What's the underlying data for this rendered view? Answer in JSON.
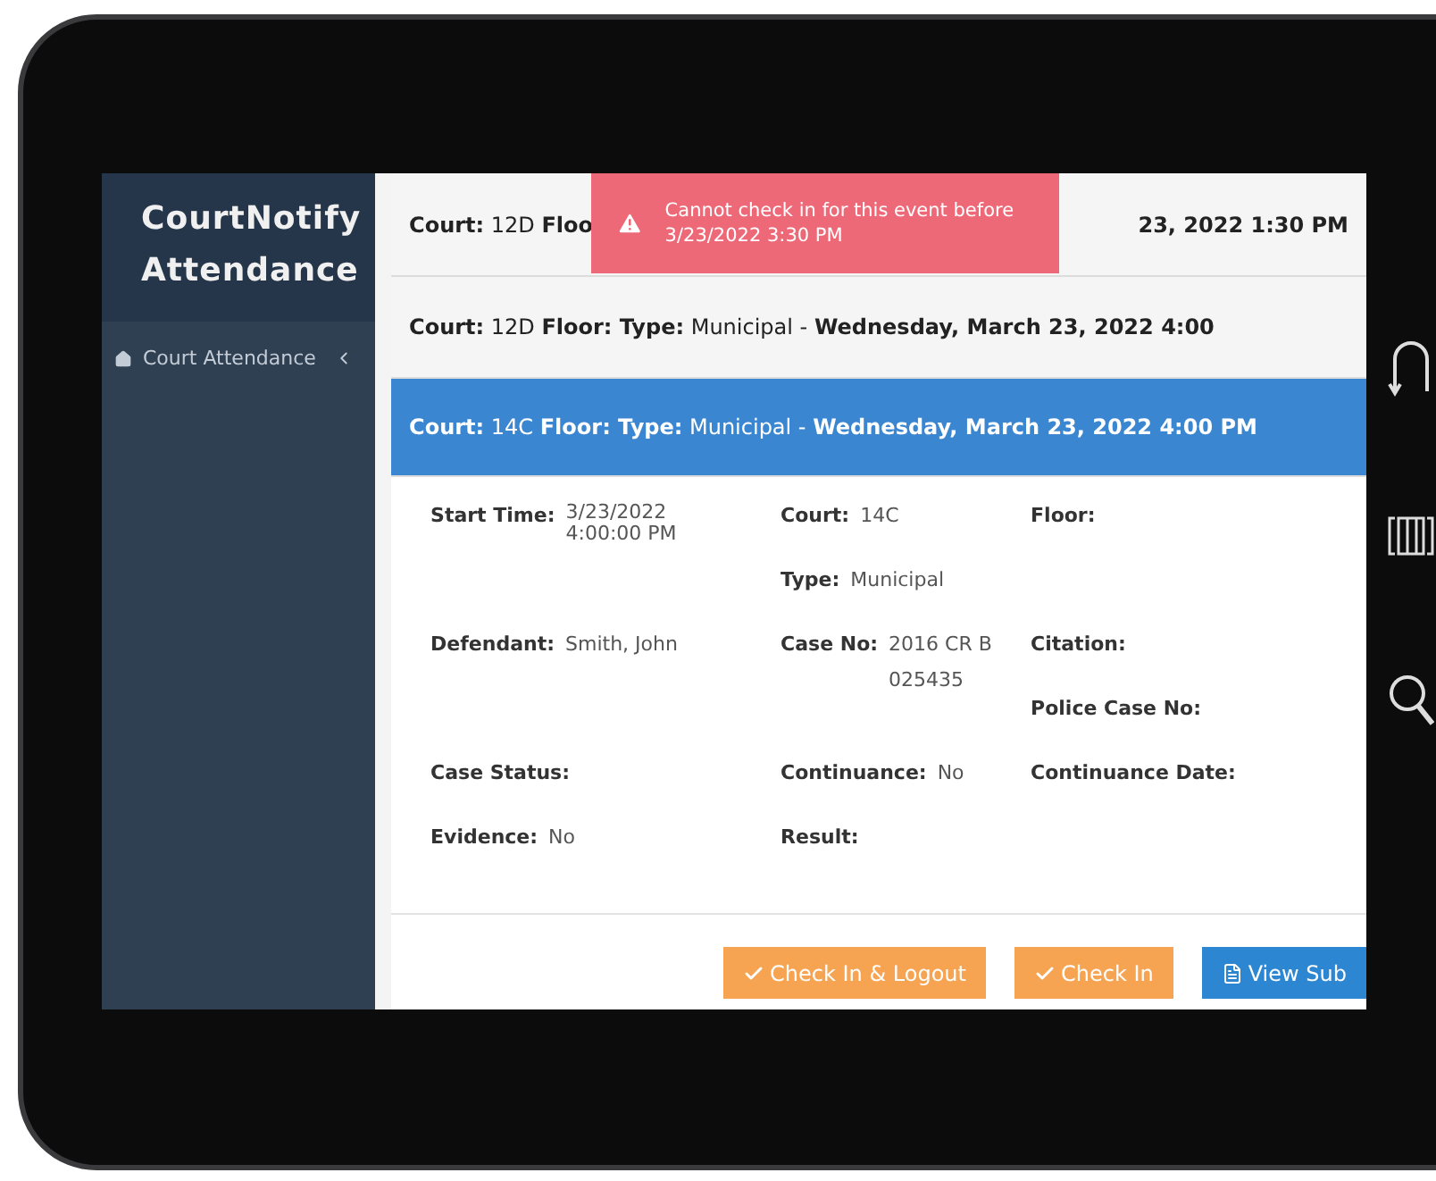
{
  "sidebar": {
    "title": "CourtNotify Attendance",
    "items": [
      {
        "label": "Court Attendance",
        "expanded": false
      }
    ]
  },
  "toast": {
    "message": "Cannot check in for this event before 3/23/2022 3:30 PM"
  },
  "events": [
    {
      "visible_parts": [
        "**Court:** 12D **Floo**",
        "**23, 2022 1:30 PM**"
      ],
      "selected": false
    },
    {
      "visible_parts": [
        "**Court:** 12D **Floor: Type:** Municipal - **Wednesday, March 23, 2022 4:00**"
      ],
      "selected": false
    },
    {
      "visible_parts": [
        "**Court:** 14C **Floor: Type:** Municipal - **Wednesday, March 23, 2022 4:00 PM**"
      ],
      "selected": true
    }
  ],
  "details": [
    [
      {
        "label": "Start Time:",
        "value": "3/23/2022 4:00:00 PM",
        "kind": "stacked"
      }
    ],
    [
      {
        "label": "Court:",
        "value": "14C",
        "kind": "inline"
      },
      {
        "label": "Type:",
        "value": "Municipal",
        "kind": "inline"
      }
    ],
    [
      {
        "label": "Floor:",
        "kind": "inline"
      }
    ],
    [
      {
        "label": "Defendant:",
        "value": "Smith, John",
        "kind": "inline"
      }
    ],
    [
      {
        "label": "Case No:",
        "value": "2016 CR B 025435",
        "kind": "inline"
      }
    ],
    [
      {
        "label": "Citation:",
        "kind": "inline"
      },
      {
        "label": "Police Case No:",
        "kind": "inline"
      }
    ],
    [
      {
        "label": "Case Status:",
        "kind": "inline"
      }
    ],
    [
      {
        "label": "Continuance:",
        "value": "No",
        "kind": "inline"
      }
    ],
    [
      {
        "label": "Continuance Date:",
        "kind": "inline"
      }
    ],
    [
      {
        "label": "Evidence:",
        "value": "No",
        "kind": "inline"
      }
    ],
    [
      {
        "label": "Result:",
        "kind": "inline"
      }
    ]
  ],
  "buttons": [
    {
      "label": "Check In & Logout",
      "kind": "warning"
    },
    {
      "label": "Check In",
      "kind": "warning"
    },
    {
      "label": "View Sub",
      "kind": "primary"
    }
  ]
}
